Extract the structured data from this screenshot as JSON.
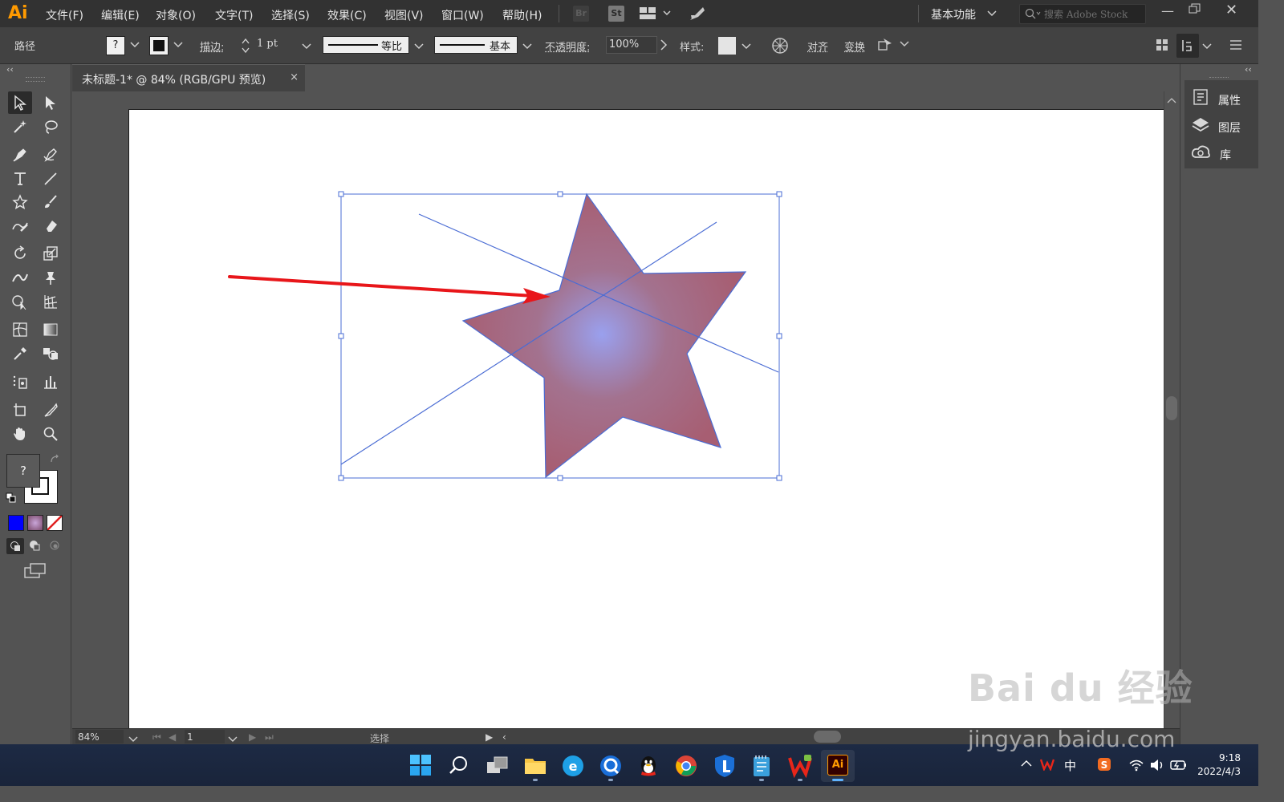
{
  "menubar": {
    "logo": "Ai",
    "menus": [
      "文件(F)",
      "编辑(E)",
      "对象(O)",
      "文字(T)",
      "选择(S)",
      "效果(C)",
      "视图(V)",
      "窗口(W)",
      "帮助(H)"
    ],
    "bridge": "Br",
    "stock": "St",
    "workspace": "基本功能",
    "search_placeholder": "搜索 Adobe Stock"
  },
  "control": {
    "selection_type": "路径",
    "fill_value": "?",
    "stroke_label": "描边:",
    "stroke_weight": "1 pt",
    "profile_label": "等比",
    "brush_label": "基本",
    "opacity_label": "不透明度:",
    "opacity_value": "100%",
    "style_label": "样式:",
    "align_label": "对齐",
    "transform_label": "变换"
  },
  "document": {
    "tab_title": "未标题-1* @ 84% (RGB/GPU 预览)",
    "close": "×"
  },
  "tools": {
    "fill_swatch": "?",
    "colors": {
      "selection": "#4a6cd4",
      "arrow": "#e8161a",
      "star_center": "#9aa0ee",
      "star_outer": "#a75e72"
    }
  },
  "right_panel": {
    "items": [
      "属性",
      "图层",
      "库"
    ]
  },
  "status": {
    "zoom": "84%",
    "artboard": "1",
    "mode": "选择"
  },
  "taskbar": {
    "ime": "中",
    "time": "9:18",
    "date": "2022/4/3",
    "app_label": "Ai"
  },
  "watermark": {
    "line1": "Bai du 经验",
    "line2": "jingyan.baidu.com"
  }
}
